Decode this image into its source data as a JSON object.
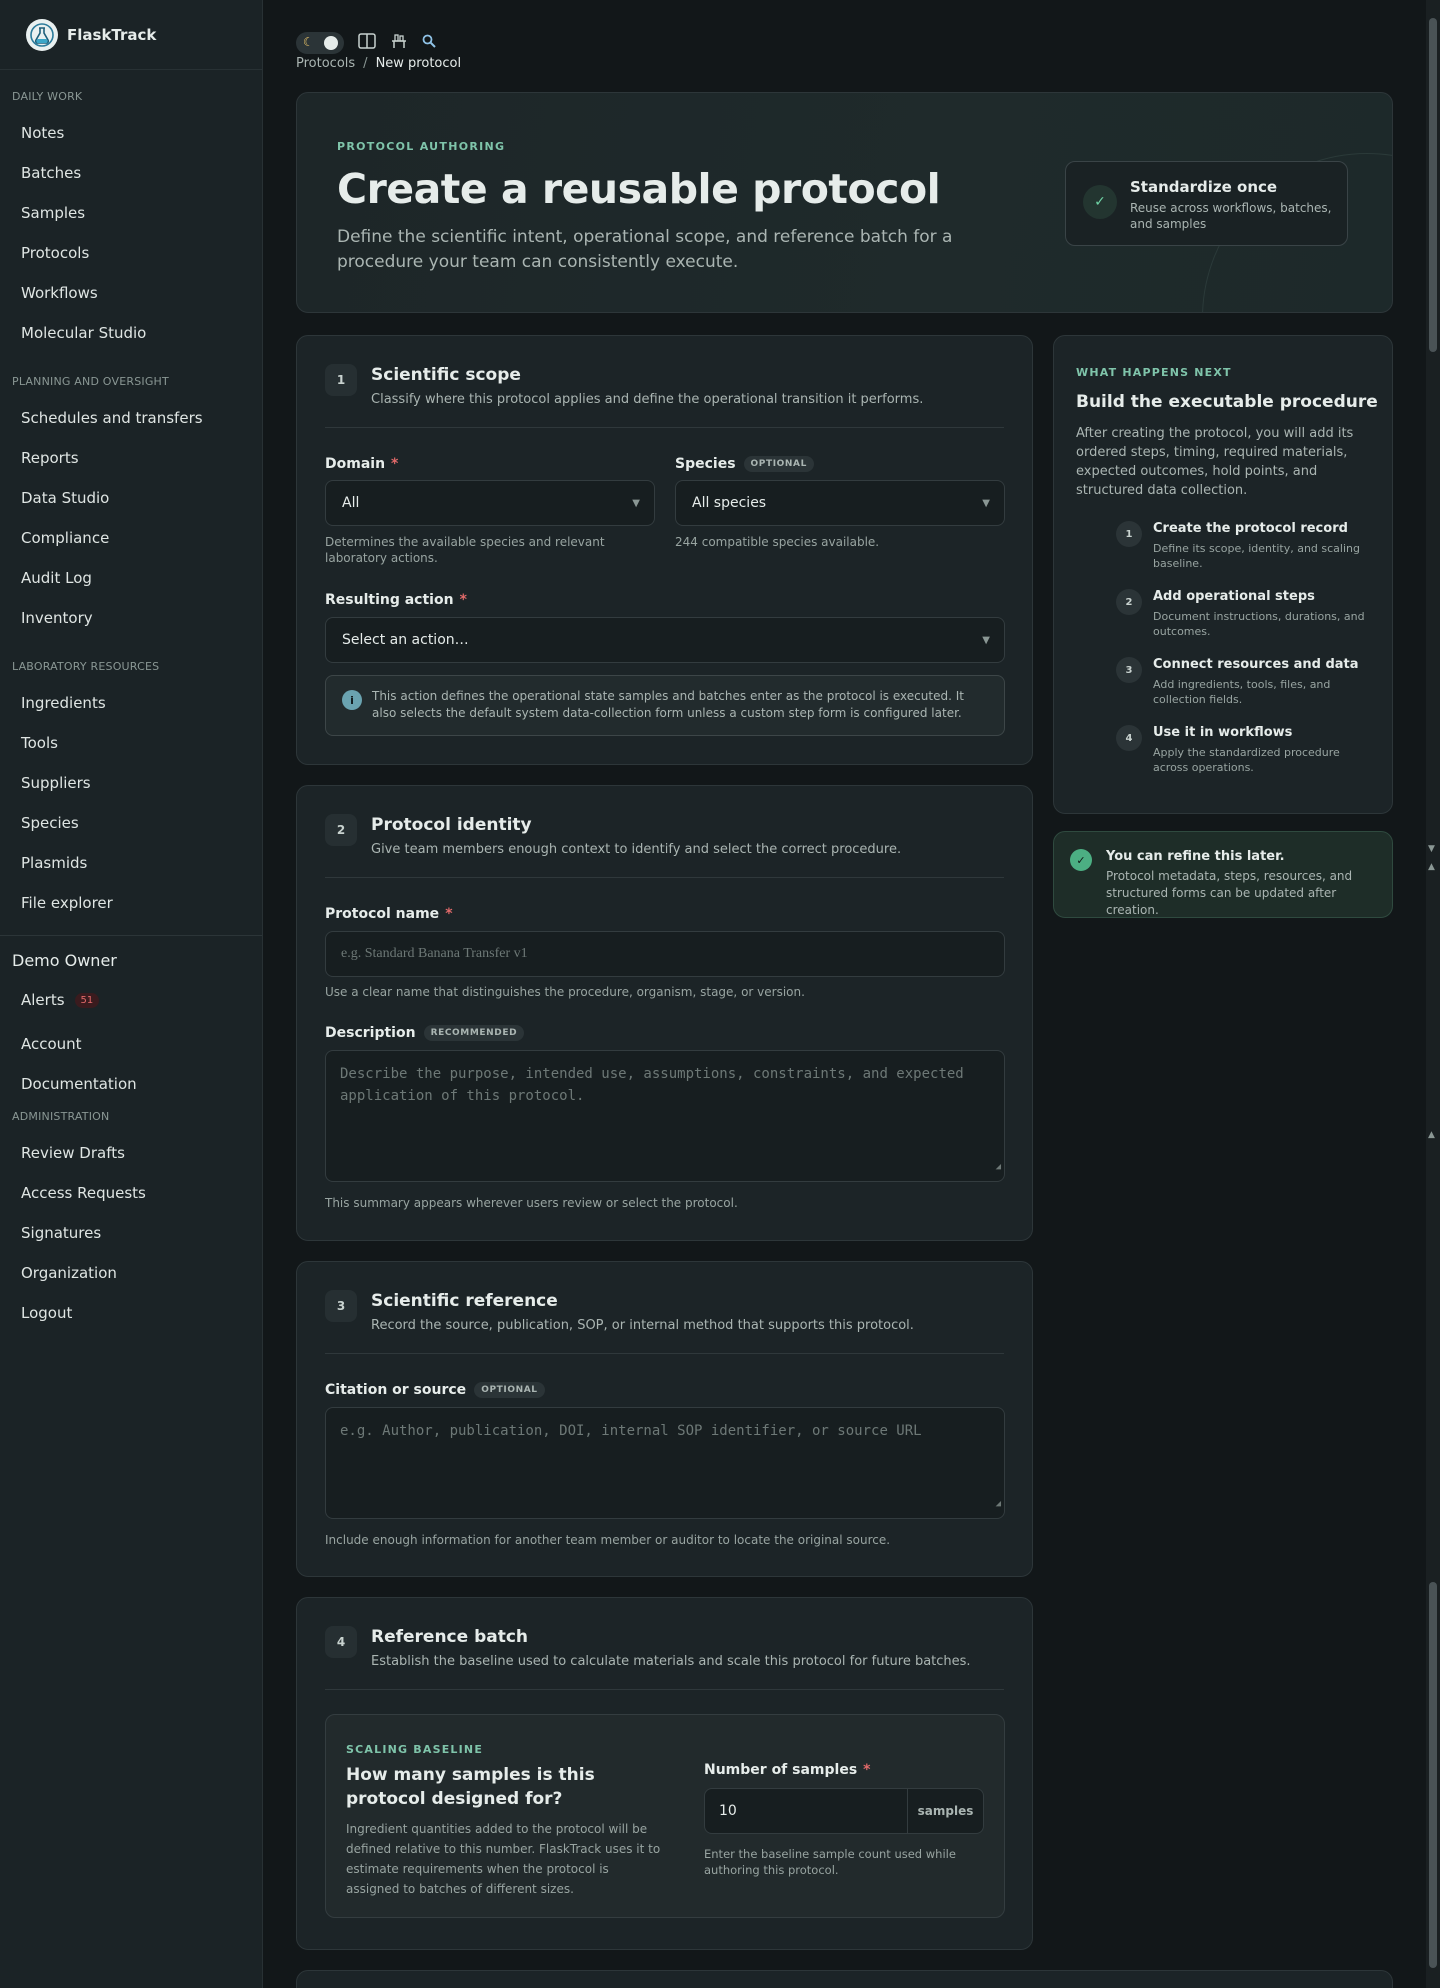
{
  "brand": {
    "name": "FlaskTrack"
  },
  "sidebar": {
    "sections": [
      {
        "title": "Daily work",
        "items": [
          "Notes",
          "Batches",
          "Samples",
          "Protocols",
          "Workflows",
          "Molecular Studio"
        ]
      },
      {
        "title": "Planning and oversight",
        "items": [
          "Schedules and transfers",
          "Reports",
          "Data Studio",
          "Compliance",
          "Audit Log",
          "Inventory"
        ]
      },
      {
        "title": "Laboratory resources",
        "items": [
          "Ingredients",
          "Tools",
          "Suppliers",
          "Species",
          "Plasmids",
          "File explorer"
        ]
      }
    ],
    "user": {
      "name": "Demo Owner",
      "alerts_label": "Alerts",
      "alerts_count": "51",
      "account": "Account",
      "documentation": "Documentation"
    },
    "admin": {
      "title": "Administration",
      "items": [
        "Review Drafts",
        "Access Requests",
        "Signatures",
        "Organization",
        "Logout"
      ]
    }
  },
  "breadcrumb": {
    "parent": "Protocols",
    "sep": "/",
    "current": "New protocol"
  },
  "hero": {
    "eyebrow": "PROTOCOL AUTHORING",
    "title": "Create a reusable protocol",
    "description": "Define the scientific intent, operational scope, and reference batch for a procedure your team can consistently execute.",
    "callout_title": "Standardize once",
    "callout_text": "Reuse across workflows, batches, and samples"
  },
  "scope": {
    "num": "1",
    "title": "Scientific scope",
    "subtitle": "Classify where this protocol applies and define the operational transition it performs.",
    "domain_label": "Domain",
    "domain_value": "All",
    "domain_help": "Determines the available species and relevant laboratory actions.",
    "species_label": "Species",
    "species_pill": "OPTIONAL",
    "species_value": "All species",
    "species_help": "244 compatible species available.",
    "action_label": "Resulting action",
    "action_value": "Select an action…",
    "info": "This action defines the operational state samples and batches enter as the protocol is executed. It also selects the default system data-collection form unless a custom step form is configured later."
  },
  "identity": {
    "num": "2",
    "title": "Protocol identity",
    "subtitle": "Give team members enough context to identify and select the correct procedure.",
    "name_label": "Protocol name",
    "name_placeholder": "e.g. Standard Banana Transfer v1",
    "name_help": "Use a clear name that distinguishes the procedure, organism, stage, or version.",
    "desc_label": "Description",
    "desc_pill": "RECOMMENDED",
    "desc_placeholder": "Describe the purpose, intended use, assumptions, constraints, and expected application of this protocol.",
    "desc_help": "This summary appears wherever users review or select the protocol."
  },
  "reference": {
    "num": "3",
    "title": "Scientific reference",
    "subtitle": "Record the source, publication, SOP, or internal method that supports this protocol.",
    "citation_label": "Citation or source",
    "citation_pill": "OPTIONAL",
    "citation_placeholder": "e.g. Author, publication, DOI, internal SOP identifier, or source URL",
    "citation_help": "Include enough information for another team member or auditor to locate the original source."
  },
  "batch": {
    "num": "4",
    "title": "Reference batch",
    "subtitle": "Establish the baseline used to calculate materials and scale this protocol for future batches.",
    "eyebrow": "SCALING BASELINE",
    "question": "How many samples is this protocol designed for?",
    "explain": "Ingredient quantities added to the protocol will be defined relative to this number. FlaskTrack uses it to estimate requirements when the protocol is assigned to batches of different sizes.",
    "samples_label": "Number of samples",
    "samples_value": "10",
    "samples_unit": "samples",
    "samples_help": "Enter the baseline sample count used while authoring this protocol."
  },
  "next": {
    "eyebrow": "WHAT HAPPENS NEXT",
    "title": "Build the executable procedure",
    "text": "After creating the protocol, you will add its ordered steps, timing, required materials, expected outcomes, hold points, and structured data collection.",
    "steps": [
      {
        "n": "1",
        "t": "Create the protocol record",
        "d": "Define its scope, identity, and scaling baseline."
      },
      {
        "n": "2",
        "t": "Add operational steps",
        "d": "Document instructions, durations, and outcomes."
      },
      {
        "n": "3",
        "t": "Connect resources and data",
        "d": "Add ingredients, tools, files, and collection fields."
      },
      {
        "n": "4",
        "t": "Use it in workflows",
        "d": "Apply the standardized procedure across operations."
      }
    ]
  },
  "refine": {
    "title": "You can refine this later.",
    "text": "Protocol metadata, steps, resources, and structured forms can be updated after creation."
  }
}
